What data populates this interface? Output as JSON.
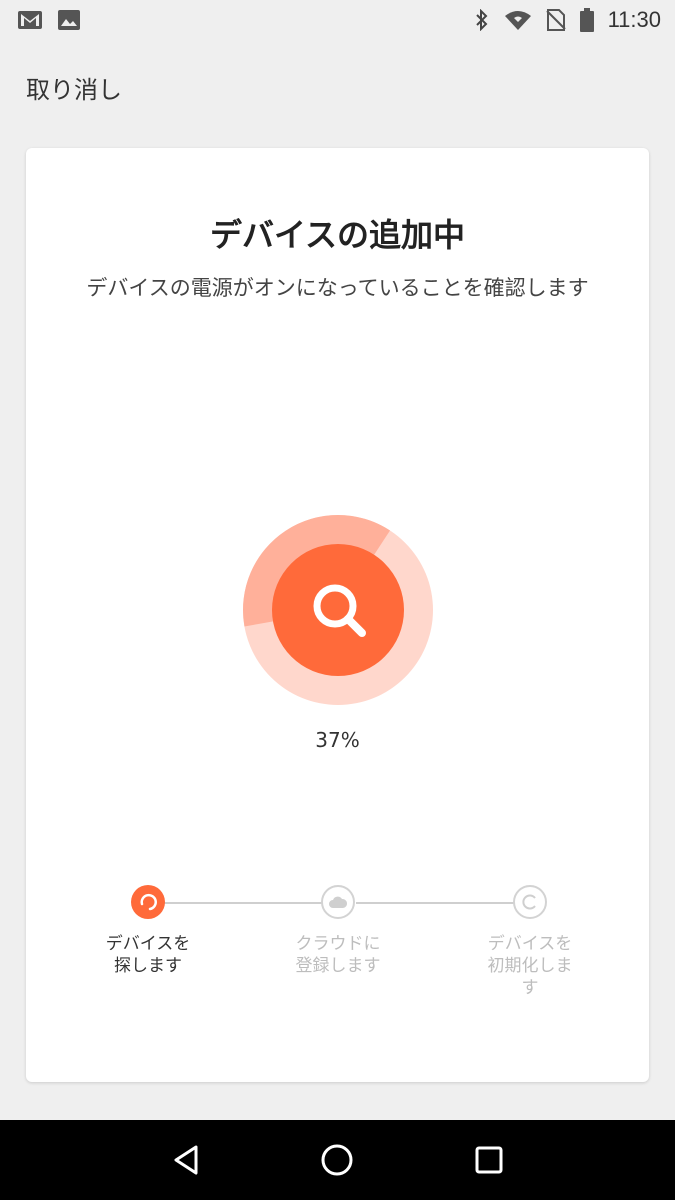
{
  "status_bar": {
    "time": "11:30",
    "left_icons": [
      "gmail-icon",
      "image-icon"
    ],
    "right_icons": [
      "bluetooth-icon",
      "wifi-icon",
      "no-sim-icon",
      "battery-icon"
    ]
  },
  "header": {
    "cancel_label": "取り消し"
  },
  "card": {
    "title": "デバイスの追加中",
    "subtitle": "デバイスの電源がオンになっていることを確認します",
    "progress": {
      "percent": 37,
      "label": "37%"
    },
    "steps": [
      {
        "label": "デバイスを\n探します",
        "state": "active",
        "icon": "loading-icon"
      },
      {
        "label": "クラウドに\n登録します",
        "state": "inactive",
        "icon": "cloud-icon"
      },
      {
        "label": "デバイスを\n初期化しま\nす",
        "state": "inactive",
        "icon": "reset-icon"
      }
    ]
  },
  "colors": {
    "accent": "#ff6a3a",
    "ring": "#ffb09a",
    "ring_light": "#ffd7cc"
  },
  "nav_bar": {
    "icons": [
      "back-icon",
      "home-icon",
      "recents-icon"
    ]
  }
}
